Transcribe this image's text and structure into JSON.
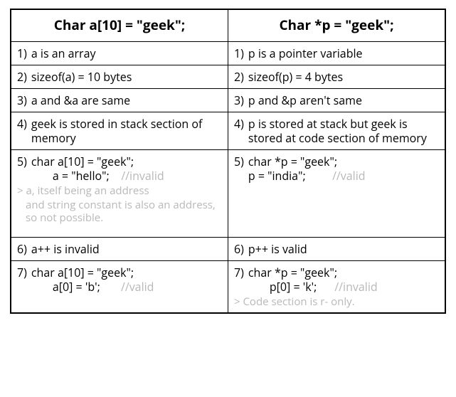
{
  "header": {
    "left": "Char a[10] = \"geek\";",
    "right": "Char *p = \"geek\";"
  },
  "rows": [
    {
      "num": "1)",
      "left": "a is an array",
      "right": "p is a pointer variable"
    },
    {
      "num": "2)",
      "left": "sizeof(a) = 10 bytes",
      "right": "sizeof(p) = 4 bytes"
    },
    {
      "num": "3)",
      "left": "a and &a are same",
      "right": "p and &p aren't same"
    },
    {
      "num": "4)",
      "left": "geek is stored in stack section of memory",
      "right": "p is stored at stack but geek is stored at code section of memory"
    },
    {
      "num": "5)",
      "left_line1": "char a[10] = \"geek\";",
      "left_line2a": "a = \"hello\";",
      "left_line2b": "//invalid",
      "left_note1": "> a, itself being an address",
      "left_note2": "and string constant is also an address, so not possible.",
      "right_line1": "char *p = \"geek\";",
      "right_line2a": "p = \"india\";",
      "right_line2b": "//valid"
    },
    {
      "num": "6)",
      "left": "a++ is invalid",
      "right": "p++ is valid"
    },
    {
      "num": "7)",
      "left_line1": "char a[10] = \"geek\";",
      "left_line2a": "a[0] = 'b';",
      "left_line2b": "//valid",
      "right_line1": "char *p = \"geek\";",
      "right_line2a": "p[0] = 'k';",
      "right_line2b": "//invalid",
      "right_note": "> Code section is r- only."
    }
  ]
}
